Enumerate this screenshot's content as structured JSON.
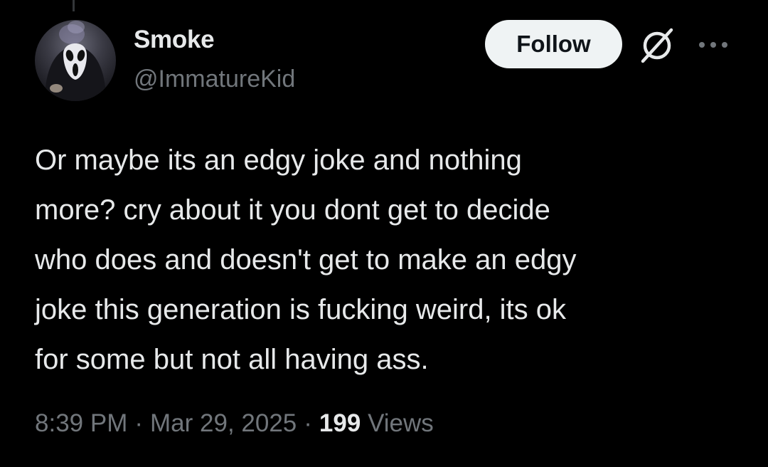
{
  "author": {
    "display_name": "Smoke",
    "handle": "@ImmatureKid",
    "avatar_icon": "ghostface-mask-avatar"
  },
  "actions": {
    "follow_label": "Follow",
    "grok_icon": "grok-icon",
    "more_icon": "more-options-icon"
  },
  "tweet": {
    "text": "Or maybe its an edgy joke and nothing\nmore? cry about it you dont get to decide\nwho does and doesn't get to make an edgy\njoke this generation is fucking weird, its ok\nfor some but not all having ass."
  },
  "meta": {
    "time": "8:39 PM",
    "separator": "·",
    "date": "Mar 29, 2025",
    "views_count": "199",
    "views_label": "Views"
  },
  "colors": {
    "background": "#000000",
    "primary_text": "#e7e9ea",
    "secondary_text": "#71767b",
    "follow_button_bg": "#eff3f4",
    "follow_button_text": "#0f1419"
  }
}
